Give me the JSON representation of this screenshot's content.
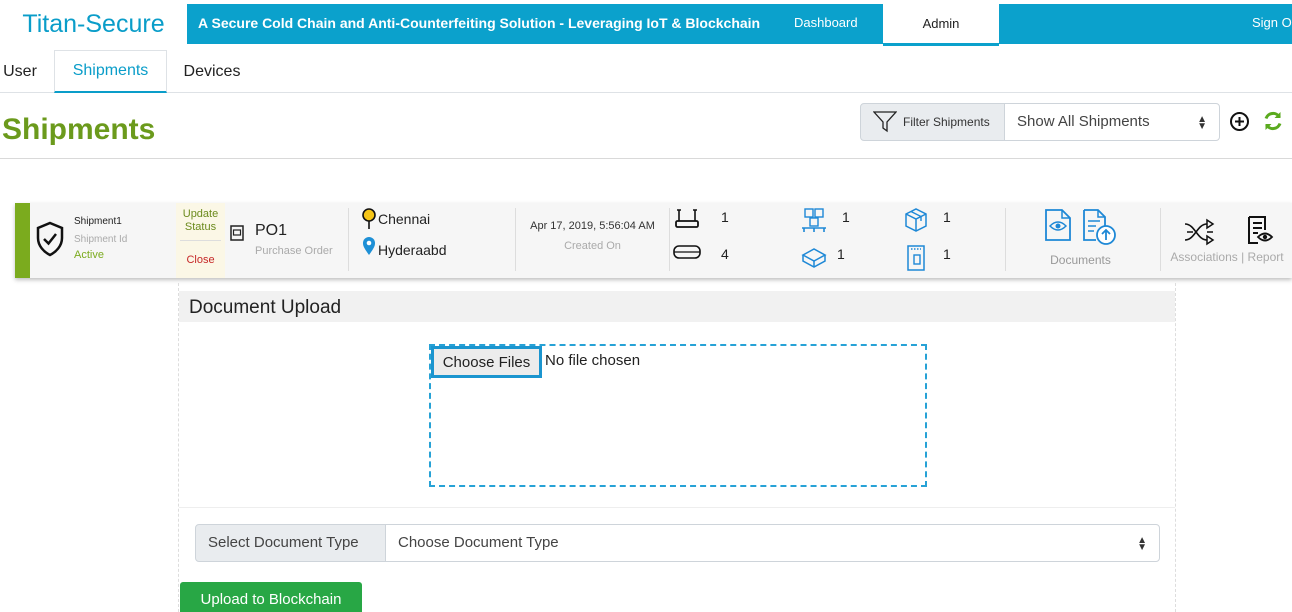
{
  "header": {
    "brand": "Titan-Secure",
    "tagline": "A Secure Cold Chain and Anti-Counterfeiting Solution - Leveraging IoT & Blockchain",
    "nav": {
      "dashboard": "Dashboard",
      "admin": "Admin",
      "signout": "Sign Out"
    },
    "banner_color": "#0ba1cc"
  },
  "tabs": [
    {
      "label": "User",
      "active": false
    },
    {
      "label": "Shipments",
      "active": true
    },
    {
      "label": "Devices",
      "active": false
    }
  ],
  "page": {
    "title": "Shipments",
    "filter_label": "Filter Shipments",
    "filter_value": "Show All Shipments"
  },
  "shipment": {
    "name": "Shipment1",
    "id_label": "Shipment Id",
    "status": "Active",
    "update_status": "Update Status",
    "close": "Close",
    "po_number": "PO1",
    "po_label": "Purchase Order",
    "origin": "Chennai",
    "destination": "Hyderaabd",
    "created_on": "Apr 17, 2019, 5:56:04 AM",
    "created_label": "Created On",
    "counts": {
      "gateways": "1",
      "sensors": "4",
      "pallets": "1",
      "trays": "1",
      "packages": "1",
      "items": "1"
    },
    "documents_label": "Documents",
    "associations_label": "Associations | Report",
    "accent_color": "#7bab1e"
  },
  "upload": {
    "title": "Document Upload",
    "choose_label": "Choose Files",
    "no_file": "No file chosen",
    "doctype_label": "Select Document Type",
    "doctype_value": "Choose Document Type",
    "submit": "Upload to Blockchain"
  }
}
